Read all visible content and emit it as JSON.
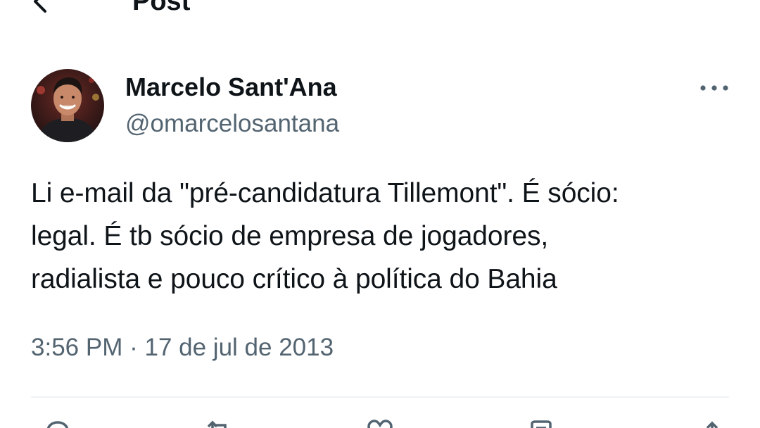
{
  "header": {
    "back_icon": "arrow-left-icon",
    "title": "Post"
  },
  "author": {
    "display_name": "Marcelo Sant'Ana",
    "handle": "@omarcelosantana",
    "avatar_icon": "profile-photo"
  },
  "menu": {
    "more_icon": "more-horizontal-icon"
  },
  "tweet": {
    "lines": [
      "Li e-mail da \"pré-candidatura Tillemont\". É sócio:",
      "legal. É tb sócio de empresa de jogadores,",
      "radialista e pouco crítico à política do Bahia"
    ]
  },
  "meta": {
    "time": "3:56 PM",
    "separator": "·",
    "date": "17 de jul de 2013"
  },
  "actions": [
    {
      "icon": "reply-icon"
    },
    {
      "icon": "retweet-icon"
    },
    {
      "icon": "like-icon"
    },
    {
      "icon": "bookmark-icon"
    },
    {
      "icon": "share-icon"
    }
  ],
  "colors": {
    "text_primary": "#0f1419",
    "text_secondary": "#536471",
    "divider": "#eff3f4"
  }
}
